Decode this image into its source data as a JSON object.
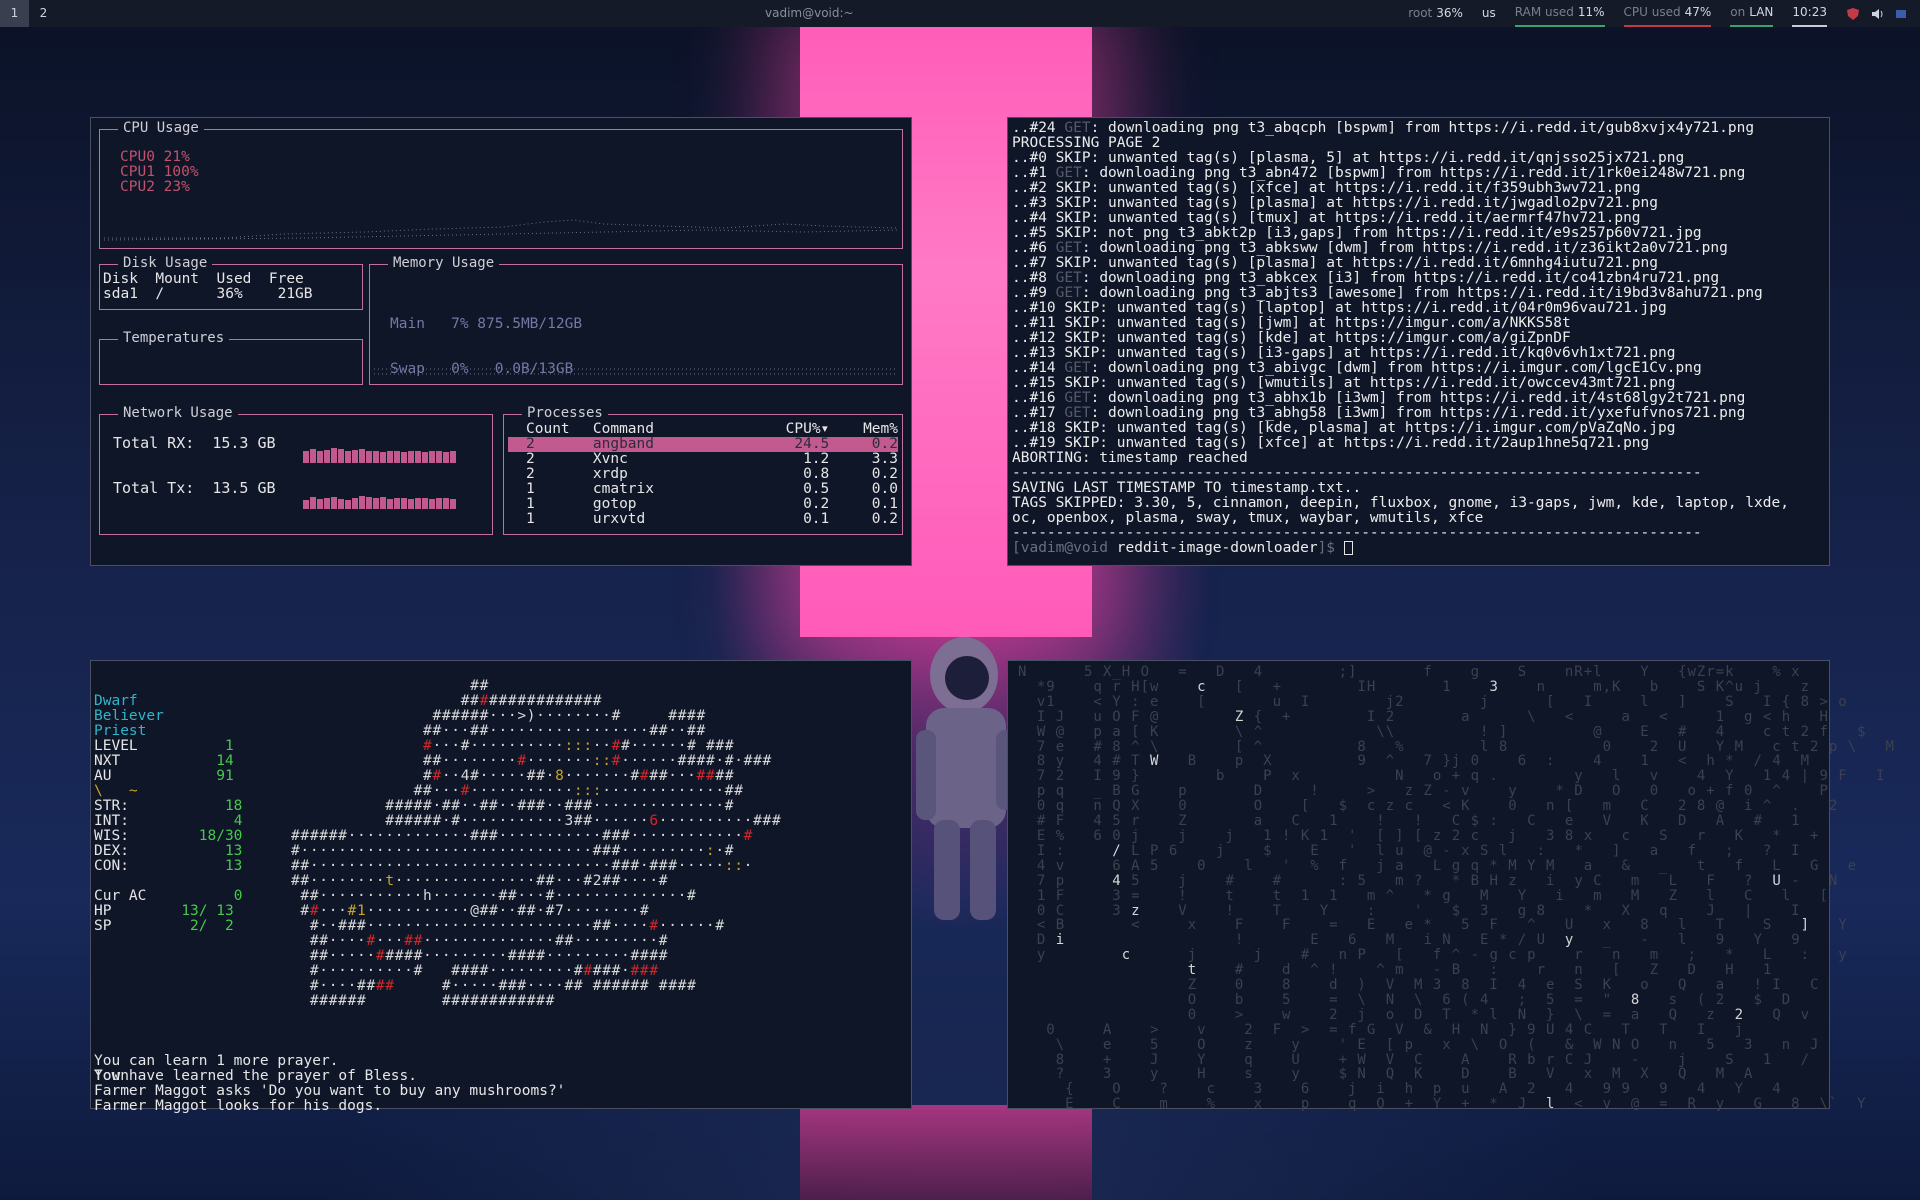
{
  "topbar": {
    "workspaces": [
      "1",
      "2"
    ],
    "title": "vadim@void:~",
    "disk": {
      "label": "root",
      "value": "36%"
    },
    "keyboard": "us",
    "ram": {
      "label": "RAM used",
      "value": "11%"
    },
    "cpu": {
      "label": "CPU used",
      "value": "47%"
    },
    "net": {
      "label": "on",
      "value": "LAN"
    },
    "clock": "10:23"
  },
  "gotop": {
    "cpu": {
      "title": "CPU Usage",
      "lines": [
        "CPU0  21%",
        "CPU1 100%",
        "CPU2  23%"
      ]
    },
    "disk": {
      "title": "Disk Usage",
      "header": "Disk  Mount  Used  Free",
      "row": "sda1  /      36%    21GB"
    },
    "memory": {
      "title": "Memory Usage",
      "lines": [
        "Main   7% 875.5MB/12GB",
        "Swap   0%   0.0B/13GB"
      ]
    },
    "temps": {
      "title": "Temperatures"
    },
    "network": {
      "title": "Network Usage",
      "rx_label": "Total RX:",
      "rx_value": "15.3 GB",
      "tx_label": "Total Tx:",
      "tx_value": "13.5 GB"
    },
    "processes": {
      "title": "Processes",
      "headers": [
        "Count",
        "Command",
        "CPU%▾",
        "Mem%"
      ],
      "rows": [
        [
          "2",
          "angband",
          "24.5",
          "0.2"
        ],
        [
          "2",
          "Xvnc",
          "1.2",
          "3.3"
        ],
        [
          "2",
          "xrdp",
          "0.8",
          "0.2"
        ],
        [
          "1",
          "cmatrix",
          "0.5",
          "0.0"
        ],
        [
          "1",
          "gotop",
          "0.2",
          "0.1"
        ],
        [
          "1",
          "urxvtd",
          "0.1",
          "0.2"
        ]
      ]
    }
  },
  "terminal": {
    "lines": [
      {
        "a": "..#24 ",
        "g": "GET",
        "b": ": downloading png t3_abqcph [bspwm] from https://i.redd.it/gub8xvjx4y721.png"
      },
      {
        "a": "PROCESSING PAGE 2"
      },
      {
        "a": "..#0 SKIP: unwanted tag(s) [plasma, 5] at https://i.redd.it/qnjsso25jx721.png"
      },
      {
        "a": "..#1 ",
        "g": "GET",
        "b": ": downloading png t3_abn472 [bspwm] from https://i.redd.it/1rk0ei248w721.png"
      },
      {
        "a": "..#2 SKIP: unwanted tag(s) [xfce] at https://i.redd.it/f359ubh3wv721.png"
      },
      {
        "a": "..#3 SKIP: unwanted tag(s) [plasma] at https://i.redd.it/jwgadlo2pv721.png"
      },
      {
        "a": "..#4 SKIP: unwanted tag(s) [tmux] at https://i.redd.it/aermrf47hv721.png"
      },
      {
        "a": "..#5 SKIP: not png t3_abkt2p [i3,gaps] from https://i.redd.it/e9s257p60v721.jpg"
      },
      {
        "a": "..#6 ",
        "g": "GET",
        "b": ": downloading png t3_abksww [dwm] from https://i.redd.it/z36ikt2a0v721.png"
      },
      {
        "a": "..#7 SKIP: unwanted tag(s) [plasma] at https://i.redd.it/6mnhg4iutu721.png"
      },
      {
        "a": "..#8 ",
        "g": "GET",
        "b": ": downloading png t3_abkcex [i3] from https://i.redd.it/co41zbn4ru721.png"
      },
      {
        "a": "..#9 ",
        "g": "GET",
        "b": ": downloading png t3_abjts3 [awesome] from https://i.redd.it/i9bd3v8ahu721.png"
      },
      {
        "a": "..#10 SKIP: unwanted tag(s) [laptop] at https://i.redd.it/04r0m96vau721.jpg"
      },
      {
        "a": "..#11 SKIP: unwanted tag(s) [jwm] at https://imgur.com/a/NKKS58t"
      },
      {
        "a": "..#12 SKIP: unwanted tag(s) [kde] at https://imgur.com/a/giZpnDF"
      },
      {
        "a": "..#13 SKIP: unwanted tag(s) [i3-gaps] at https://i.redd.it/kq0v6vh1xt721.png"
      },
      {
        "a": "..#14 ",
        "g": "GET",
        "b": ": downloading png t3_abivgc [dwm] from https://i.imgur.com/lgcE1Cv.png"
      },
      {
        "a": "..#15 SKIP: unwanted tag(s) [wmutils] at https://i.redd.it/owccev43mt721.png"
      },
      {
        "a": "..#16 ",
        "g": "GET",
        "b": ": downloading png t3_abhx1b [i3wm] from https://i.redd.it/4st68lgy2t721.png"
      },
      {
        "a": "..#17 ",
        "g": "GET",
        "b": ": downloading png t3_abhg58 [i3wm] from https://i.redd.it/yxefufvnos721.png"
      },
      {
        "a": "..#18 SKIP: unwanted tag(s) [kde, plasma] at https://i.imgur.com/pVaZqNo.jpg"
      },
      {
        "a": "..#19 SKIP: unwanted tag(s) [xfce] at https://i.redd.it/2aup1hne5q721.png"
      },
      {
        "a": "ABORTING: timestamp reached"
      },
      {
        "a": "-------------------------------------------------------------------------------"
      },
      {
        "a": "SAVING LAST TIMESTAMP TO timestamp.txt.."
      },
      {
        "a": "TAGS SKIPPED: 3.30, 5, cinnamon, deepin, fluxbox, gnome, i3-gaps, jwm, kde, laptop, lxde,"
      },
      {
        "a": "oc, openbox, plasma, sway, tmux, waybar, wmutils, xfce"
      },
      {
        "a": "-------------------------------------------------------------------------------"
      }
    ],
    "prompt": "[vadim@void ",
    "prompt_dir": "reddit-image-downloader",
    "prompt_end": "]$ "
  },
  "angband": {
    "race": "Dwarf",
    "title": "Believer",
    "class": "Priest",
    "stats": [
      [
        "LEVEL",
        "1"
      ],
      [
        "NXT",
        "14"
      ],
      [
        "AU",
        "91"
      ]
    ],
    "equip": "\\   ~",
    "attrs": [
      [
        "STR:",
        "18"
      ],
      [
        "INT:",
        "4"
      ],
      [
        "WIS:",
        "18/30"
      ],
      [
        "DEX:",
        "13"
      ],
      [
        "CON:",
        "13"
      ]
    ],
    "ac": [
      "Cur AC",
      "0"
    ],
    "hp": [
      "HP",
      "13/ 13"
    ],
    "sp": [
      "SP",
      "2/  2"
    ],
    "location": "Town",
    "messages": [
      "You can learn 1 more prayer.",
      "You have learned the prayer of Bless.",
      "Farmer Maggot asks 'Do you want to buy any mushrooms?'",
      "Farmer Maggot looks for his dogs."
    ]
  },
  "colors": {
    "accent": "#c2598f",
    "term_bg": "#0f1628",
    "beam": "#ff6ec4"
  }
}
